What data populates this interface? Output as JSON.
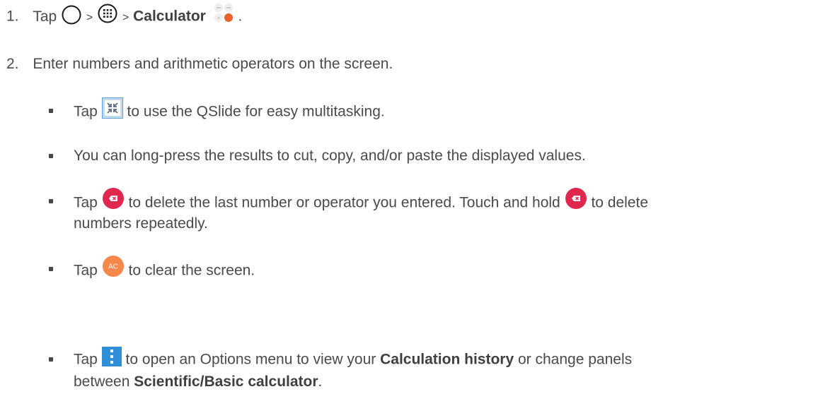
{
  "step1": {
    "number": "1.",
    "tap": "Tap",
    "sep1": ">",
    "sep2": ">",
    "app_name": "Calculator",
    "end": "."
  },
  "step2": {
    "number": "2.",
    "text": "Enter numbers and arithmetic operators on the screen."
  },
  "bullets": {
    "b1": {
      "tap": "Tap",
      "after": "to use the QSlide for easy multitasking."
    },
    "b2": {
      "text": "You can long-press the results to cut, copy, and/or paste the displayed values."
    },
    "b3": {
      "tap": "Tap",
      "middle": "to delete the last number or operator you entered. Touch and hold",
      "after": "to delete",
      "line2": "numbers repeatedly."
    },
    "b4": {
      "tap": "Tap",
      "icon_label": "AC",
      "after": "to clear the screen."
    },
    "b5": {
      "tap": "Tap",
      "after": "to open an Options menu to view your",
      "bold1": "Calculation history",
      "after2": "or change panels",
      "line2_pre": "between",
      "bold2": "Scientific/Basic calculator",
      "line2_end": "."
    }
  },
  "colors": {
    "text": "#4a4a4a",
    "calc_orange": "#e8622a",
    "delete_red": "#e0284f",
    "clear_orange": "#f7874a",
    "menu_blue": "#2e8ed8",
    "qslide_blue": "#5b9bd5"
  },
  "icons": [
    "home-icon",
    "apps-icon",
    "calculator-app-icon",
    "qslide-icon",
    "delete-icon",
    "clear-icon",
    "menu-icon"
  ]
}
